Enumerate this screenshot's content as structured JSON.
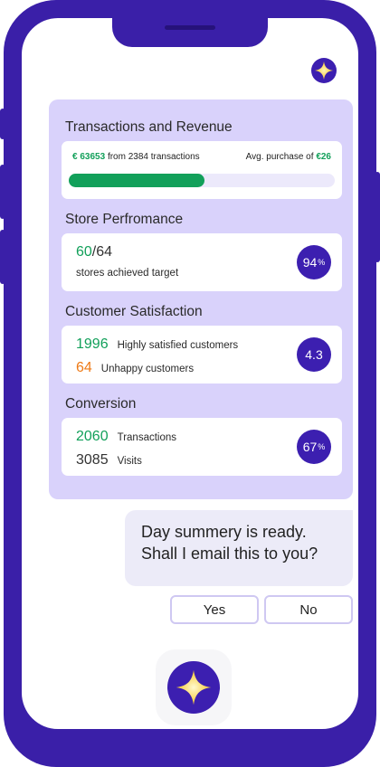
{
  "transactions": {
    "title": "Transactions and Revenue",
    "revenue": "€ 63653",
    "from_text": "from 2384 transactions",
    "avg_label": "Avg. purchase of",
    "avg_value": "€26",
    "progress_fraction": 0.51
  },
  "store": {
    "title": "Store Perfromance",
    "achieved": "60",
    "total": "/64",
    "caption": "stores achieved target",
    "percent": "94",
    "percent_sign": "%"
  },
  "satisfaction": {
    "title": "Customer Satisfaction",
    "happy_count": "1996",
    "happy_label": "Highly satisfied customers",
    "unhappy_count": "64",
    "unhappy_label": "Unhappy customers",
    "score": "4.3"
  },
  "conversion": {
    "title": "Conversion",
    "transactions_count": "2060",
    "transactions_label": "Transactions",
    "visits_count": "3085",
    "visits_label": "Visits",
    "percent": "67",
    "percent_sign": "%"
  },
  "chat": {
    "line1": "Day summery is ready.",
    "line2": "Shall I email this to you?",
    "yes": "Yes",
    "no": "No"
  },
  "colors": {
    "brand": "#3c1fb0",
    "green": "#12a05a",
    "orange": "#ee7a16",
    "panel": "#d9d2fb"
  },
  "icons": {
    "assistant": "sparkle-icon"
  }
}
